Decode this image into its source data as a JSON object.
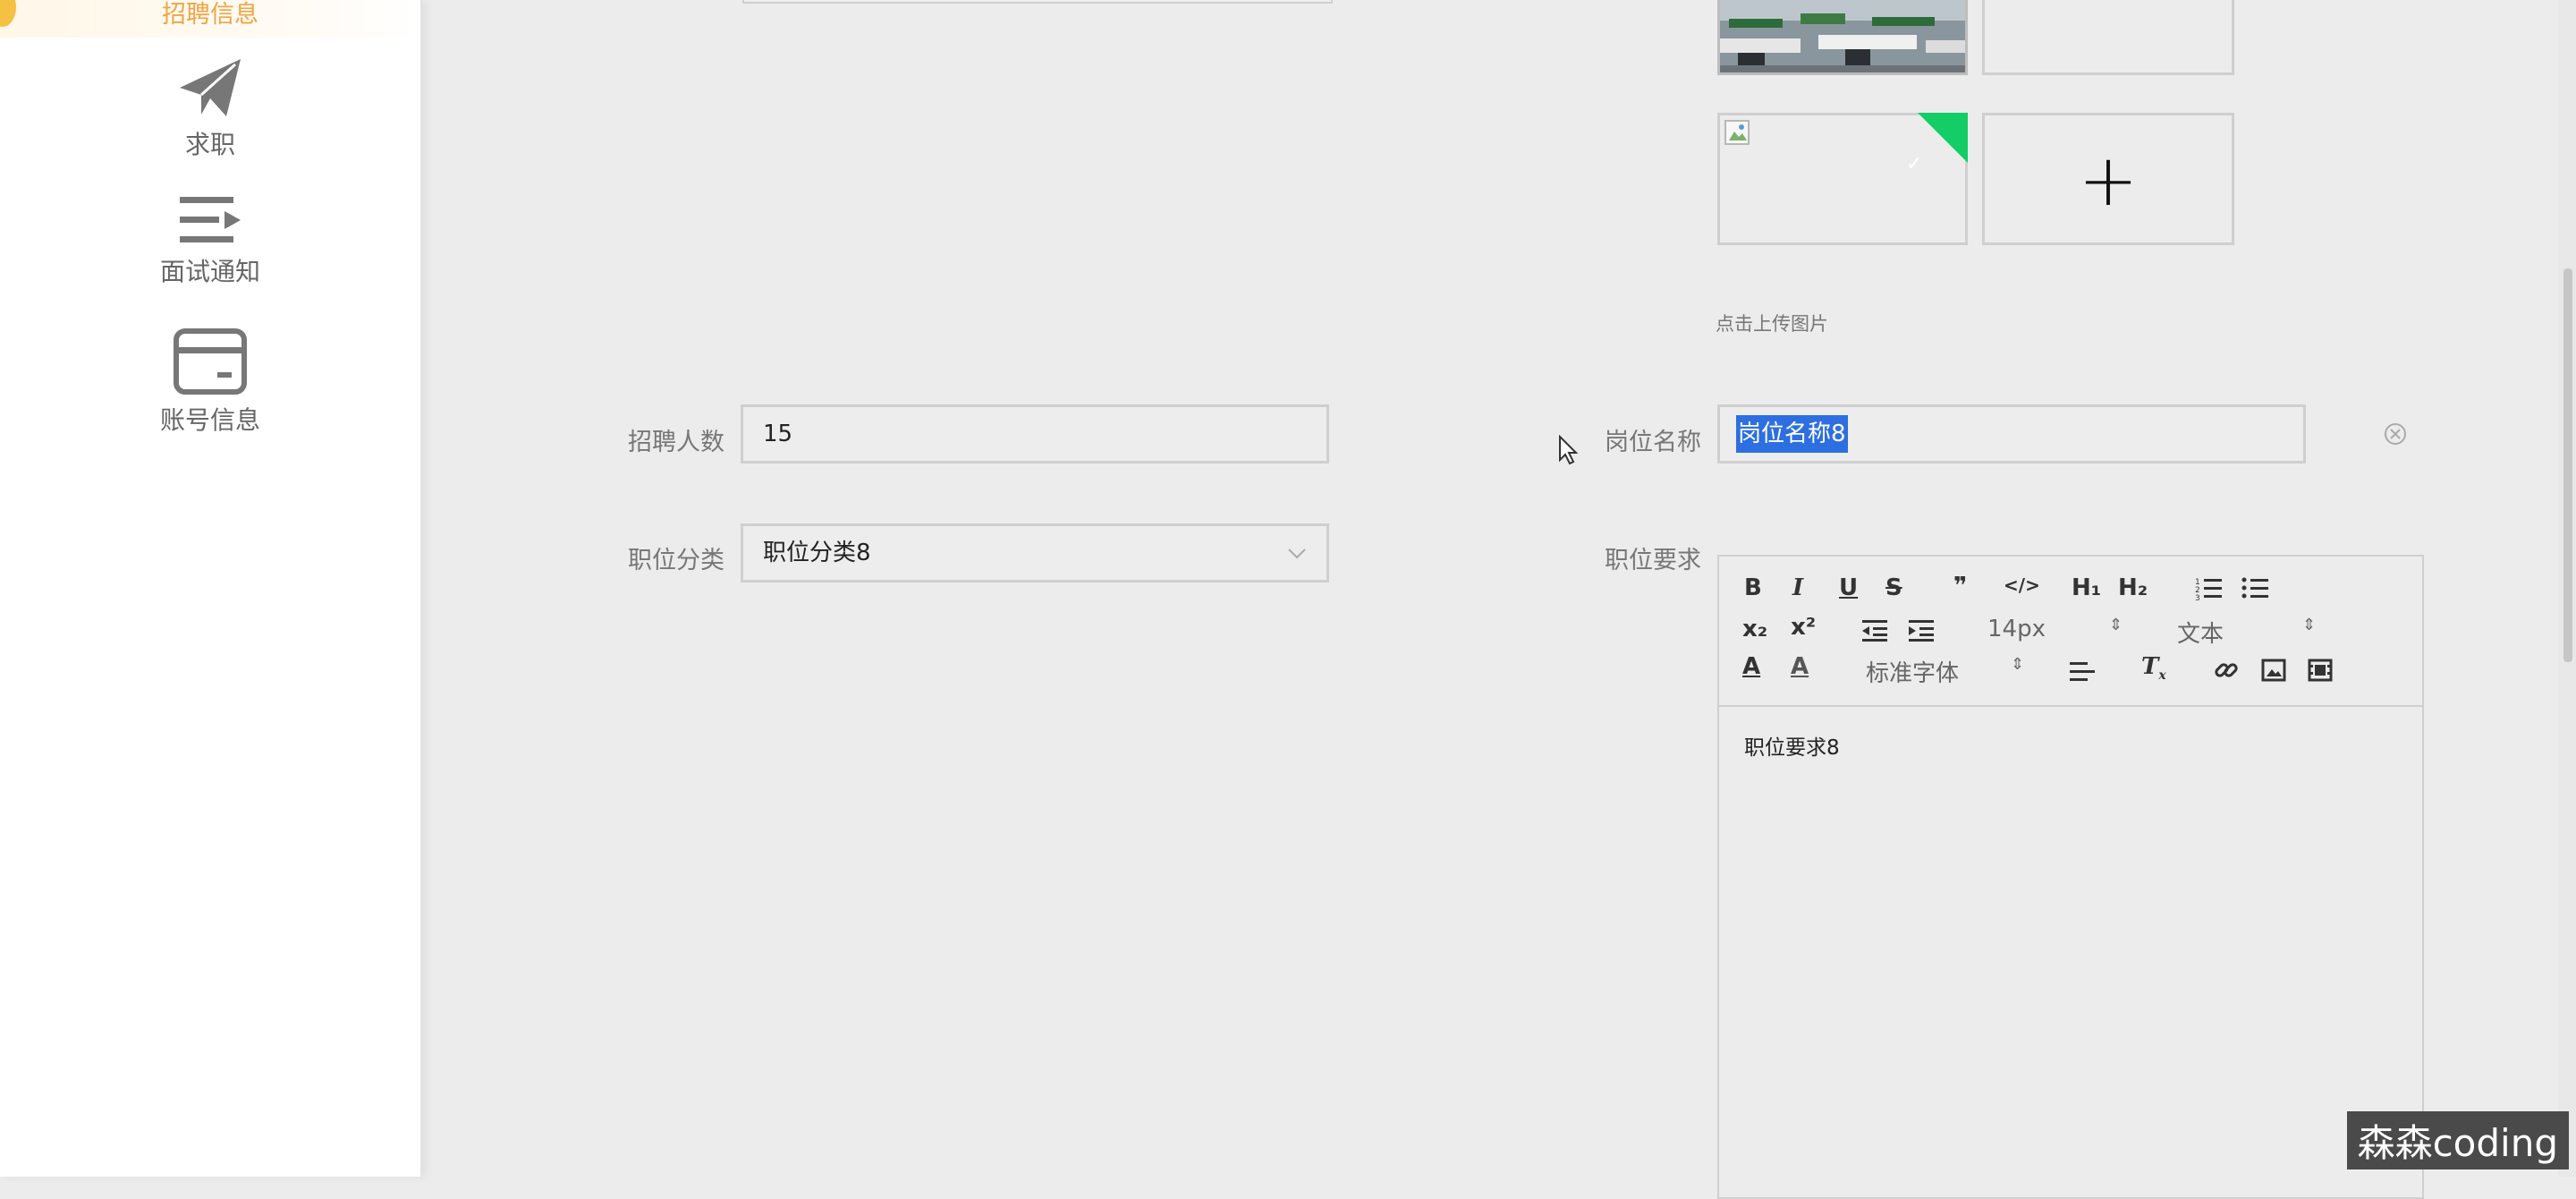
{
  "sidebar": {
    "active_item": "招聘信息",
    "items": [
      {
        "label": "求职",
        "icon": "paper-plane-icon"
      },
      {
        "label": "面试通知",
        "icon": "list-arrow-icon"
      },
      {
        "label": "账号信息",
        "icon": "card-icon"
      }
    ]
  },
  "upload": {
    "hint": "点击上传图片",
    "add_symbol": "+"
  },
  "form": {
    "headcount_label": "招聘人数",
    "headcount_value": "15",
    "category_label": "职位分类",
    "category_value": "职位分类8",
    "job_name_label": "岗位名称",
    "job_name_value": "岗位名称8",
    "requirements_label": "职位要求",
    "requirements_content": "职位要求8"
  },
  "editor_toolbar": {
    "bold": "B",
    "italic": "I",
    "underline": "U",
    "strike": "S",
    "quote": "❞",
    "code": "</>",
    "h1": "H₁",
    "h2": "H₂",
    "subscript": "x₂",
    "superscript": "x²",
    "font_size": "14px",
    "text_type": "文本",
    "font_family": "标准字体"
  },
  "watermark": "森森coding",
  "colors": {
    "accent": "#f0a544",
    "selection": "#2d6fe0",
    "check_corner": "#13ce66"
  }
}
